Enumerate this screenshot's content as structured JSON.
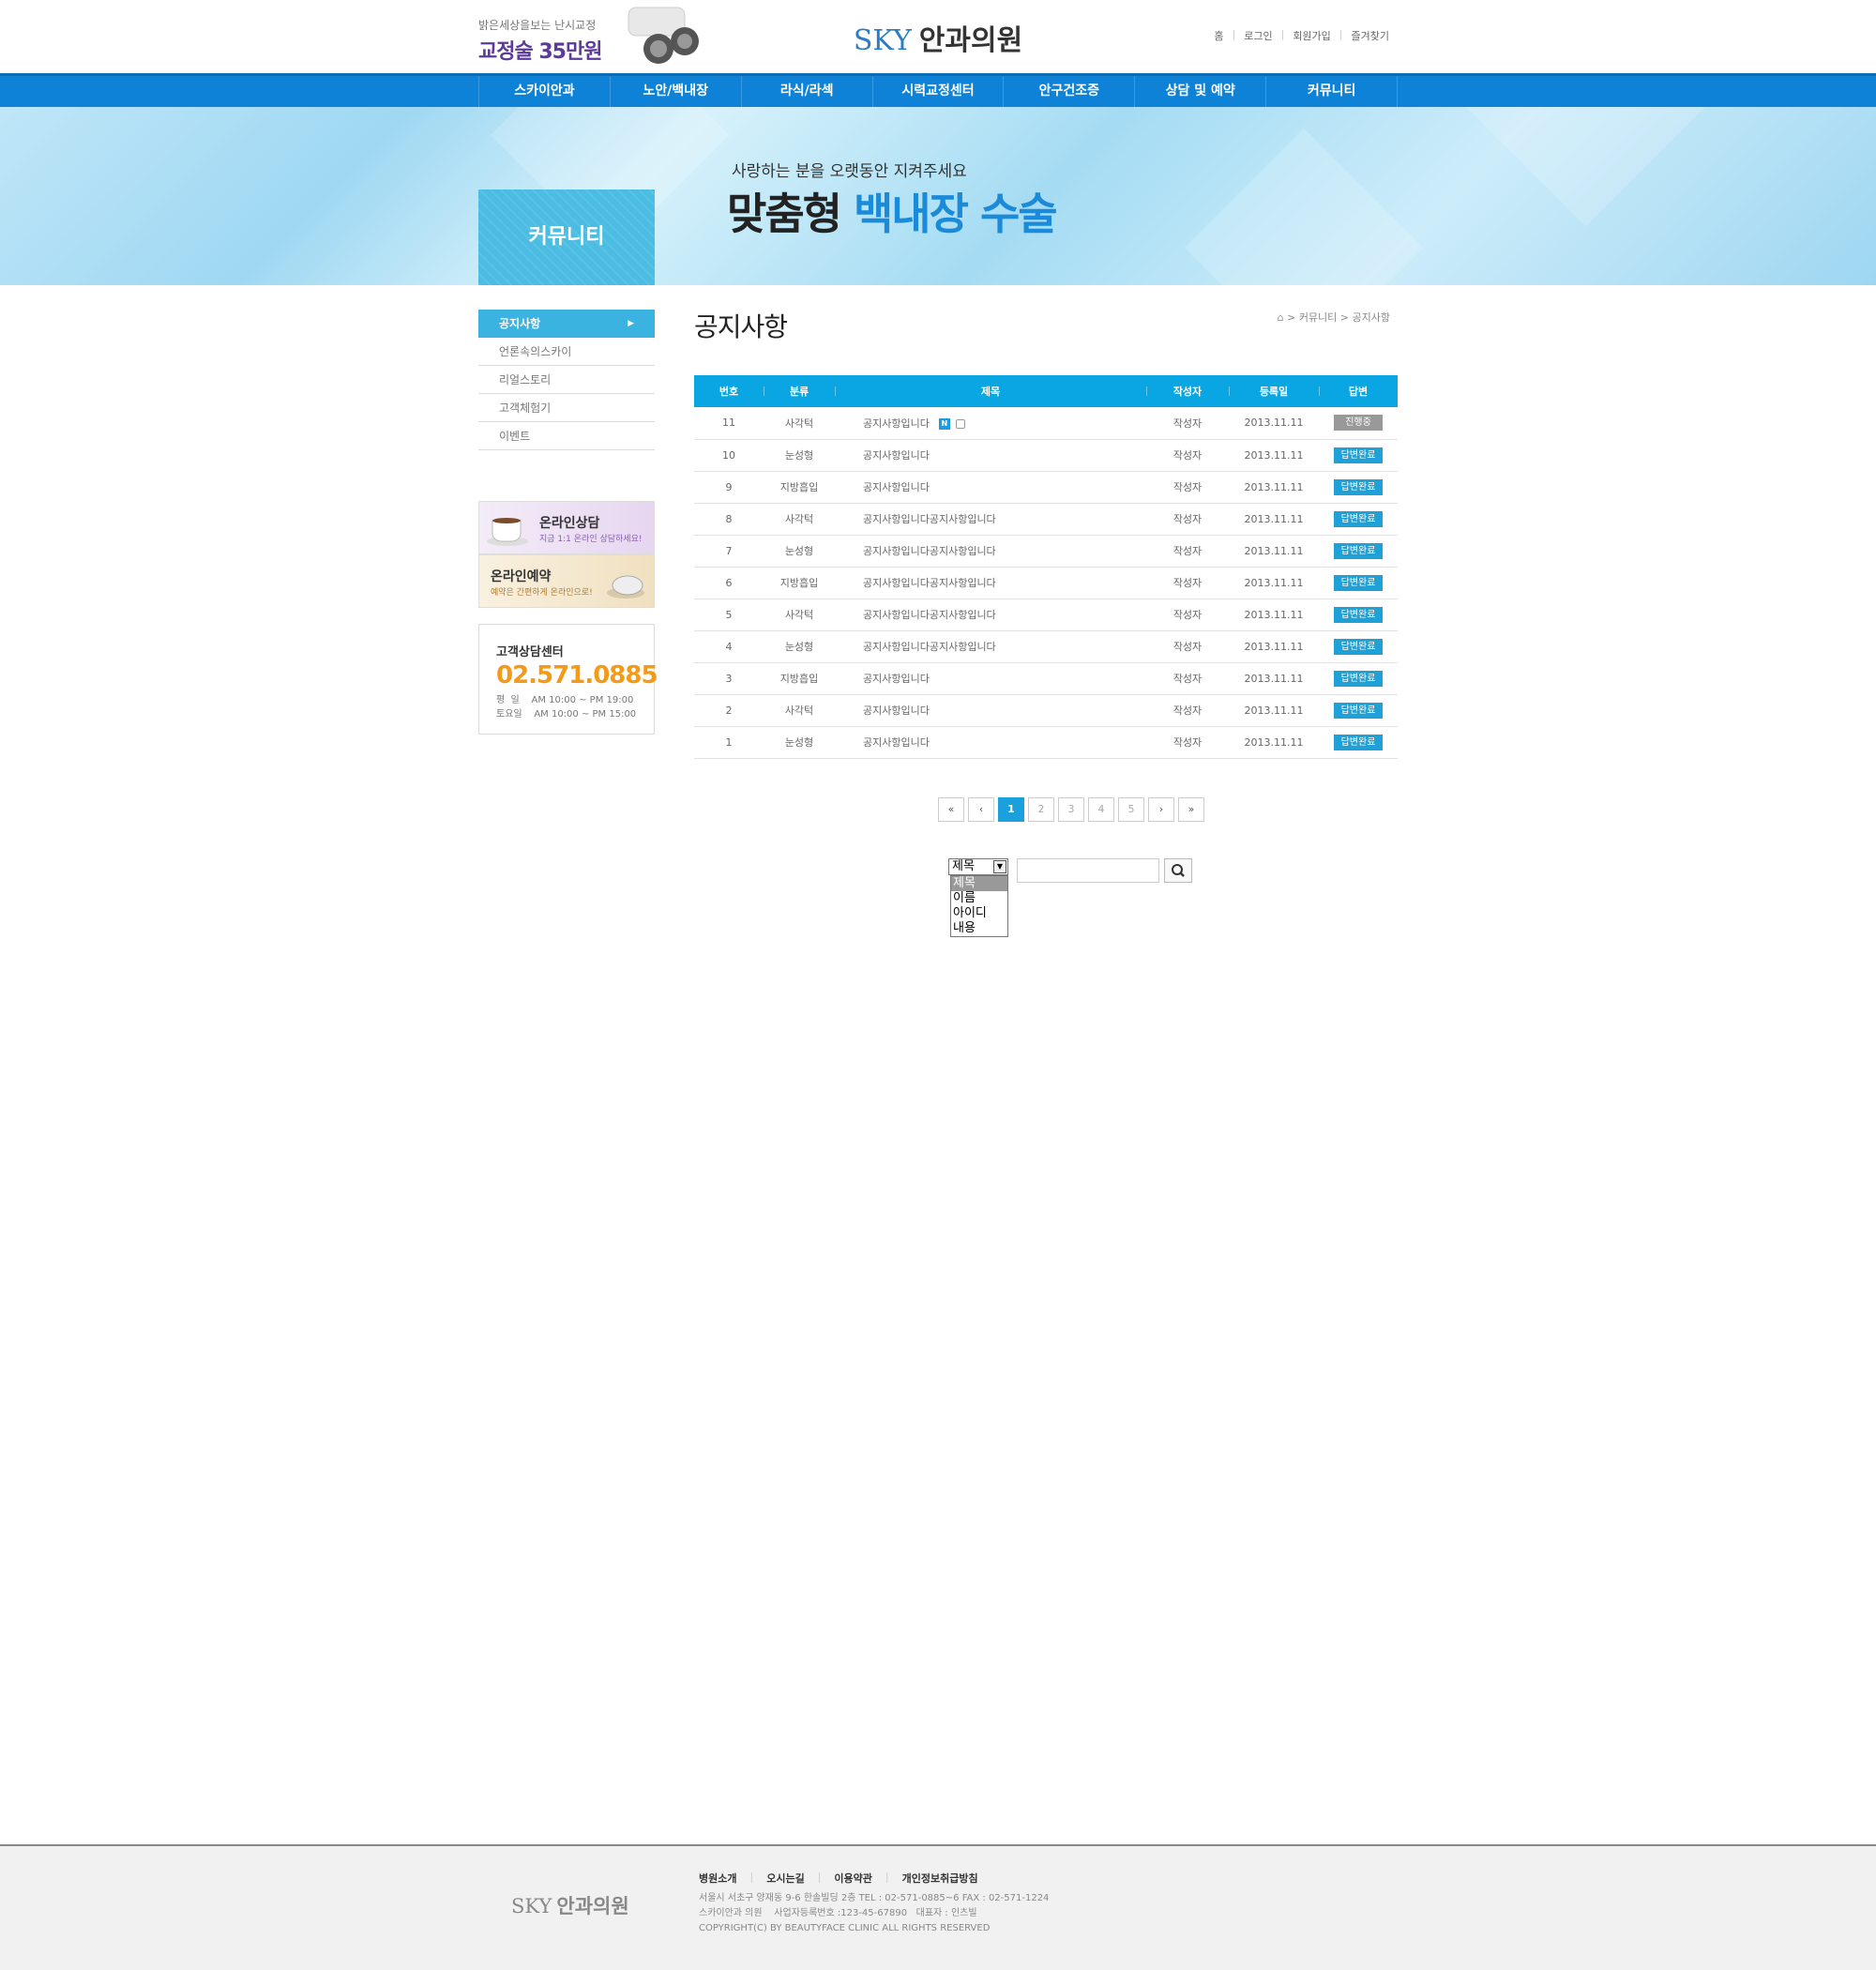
{
  "header": {
    "promo_line1": "밝은세상을보는 난시교정",
    "promo_line2": "교정술 35만원",
    "logo_en": "SKY",
    "logo_ko": "안과의원",
    "util": [
      "홈",
      "로그인",
      "회원가입",
      "즐겨찾기"
    ]
  },
  "gnb": [
    "스카이안과",
    "노안/백내장",
    "라식/라섹",
    "시력교정센터",
    "안구건조증",
    "상담 및 예약",
    "커뮤니티"
  ],
  "visual": {
    "sub": "사랑하는 분을 오랫동안 지켜주세요",
    "main_a": "맞춤형",
    "main_b": "백내장 수술",
    "section": "커뮤니티"
  },
  "lnb": [
    "공지사항",
    "언론속의스카이",
    "리얼스토리",
    "고객체험기",
    "이벤트"
  ],
  "banners": {
    "consult_title": "온라인상담",
    "consult_sub": "지금 1:1 온라인 상담하세요!",
    "reserve_title": "온라인예약",
    "reserve_sub": "예약은 간편하게 온라인으로!"
  },
  "callcenter": {
    "title": "고객상담센터",
    "phone": "02.571.0885",
    "weekday": "평  일    AM 10:00 ~ PM 19:00",
    "saturday": "토요일    AM 10:00 ~ PM 15:00"
  },
  "page_title": "공지사항",
  "breadcrumb": [
    "커뮤니티",
    "공지사항"
  ],
  "board": {
    "headers": [
      "번호",
      "분류",
      "제목",
      "작성자",
      "등록일",
      "답변"
    ],
    "rows": [
      {
        "no": "11",
        "cat": "사각턱",
        "title": "공지사항입니다",
        "new": true,
        "writer": "작성자",
        "date": "2013.11.11",
        "status": "진행중",
        "done": false
      },
      {
        "no": "10",
        "cat": "눈성형",
        "title": "공지사항입니다",
        "new": false,
        "writer": "작성자",
        "date": "2013.11.11",
        "status": "답변완료",
        "done": true
      },
      {
        "no": "9",
        "cat": "지방흡입",
        "title": "공지사항입니다",
        "new": false,
        "writer": "작성자",
        "date": "2013.11.11",
        "status": "답변완료",
        "done": true
      },
      {
        "no": "8",
        "cat": "사각턱",
        "title": "공지사항입니다공지사항입니다",
        "new": false,
        "writer": "작성자",
        "date": "2013.11.11",
        "status": "답변완료",
        "done": true
      },
      {
        "no": "7",
        "cat": "눈성형",
        "title": "공지사항입니다공지사항입니다",
        "new": false,
        "writer": "작성자",
        "date": "2013.11.11",
        "status": "답변완료",
        "done": true
      },
      {
        "no": "6",
        "cat": "지방흡입",
        "title": "공지사항입니다공지사항입니다",
        "new": false,
        "writer": "작성자",
        "date": "2013.11.11",
        "status": "답변완료",
        "done": true
      },
      {
        "no": "5",
        "cat": "사각턱",
        "title": "공지사항입니다공지사항입니다",
        "new": false,
        "writer": "작성자",
        "date": "2013.11.11",
        "status": "답변완료",
        "done": true
      },
      {
        "no": "4",
        "cat": "눈성형",
        "title": "공지사항입니다공지사항입니다",
        "new": false,
        "writer": "작성자",
        "date": "2013.11.11",
        "status": "답변완료",
        "done": true
      },
      {
        "no": "3",
        "cat": "지방흡입",
        "title": "공지사항입니다",
        "new": false,
        "writer": "작성자",
        "date": "2013.11.11",
        "status": "답변완료",
        "done": true
      },
      {
        "no": "2",
        "cat": "사각턱",
        "title": "공지사항입니다",
        "new": false,
        "writer": "작성자",
        "date": "2013.11.11",
        "status": "답변완료",
        "done": true
      },
      {
        "no": "1",
        "cat": "눈성형",
        "title": "공지사항입니다",
        "new": false,
        "writer": "작성자",
        "date": "2013.11.11",
        "status": "답변완료",
        "done": true
      }
    ]
  },
  "paging": {
    "first": "«",
    "prev": "‹",
    "pages": [
      "1",
      "2",
      "3",
      "4",
      "5"
    ],
    "current": "1",
    "next": "›",
    "last": "»"
  },
  "search": {
    "selected": "제목",
    "options": [
      "제목",
      "이름",
      "아이디",
      "내용"
    ],
    "value": ""
  },
  "footer": {
    "logo_en": "SKY",
    "logo_ko": "안과의원",
    "menu": [
      "병원소개",
      "오시는길",
      "이용약관",
      "개인정보취급방침"
    ],
    "address": "서울시 서초구 양재동 9-6  한솔빌딩 2층  TEL : 02-571-0885~6   FAX : 02-571-1224",
    "biz": "스카이안과 의원    사업자등록번호 :123-45-67890   대표자 : 인츠빌",
    "copyright": "COPYRIGHT(C) BY BEAUTYFACE CLINIC ALL RIGHTS RESERVED"
  },
  "colors": {
    "primary": "#0e82d6",
    "accent": "#09a6e3",
    "phone": "#f39a18"
  }
}
